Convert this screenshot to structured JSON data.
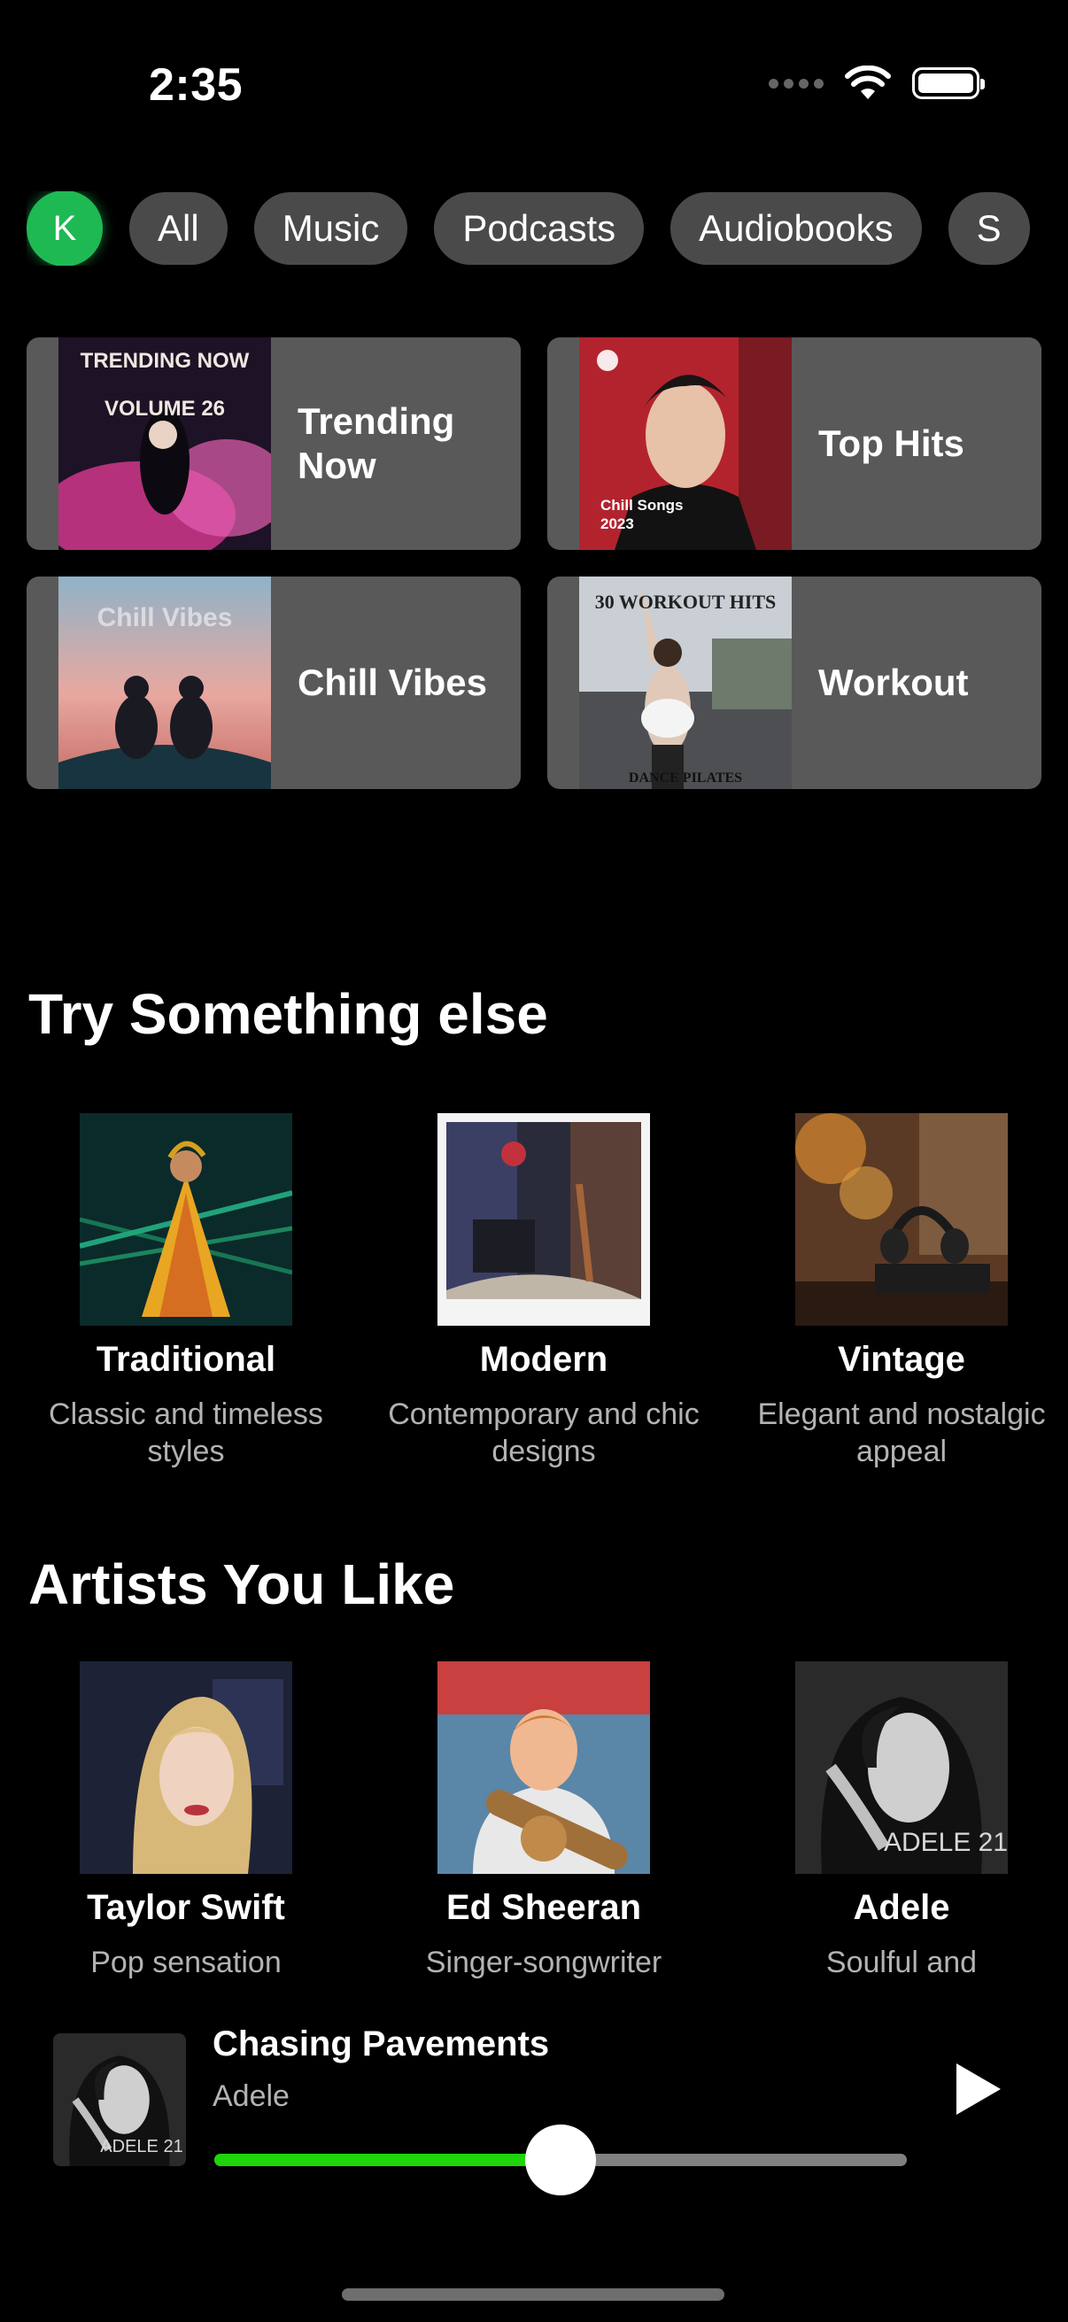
{
  "status_bar": {
    "time": "2:35"
  },
  "filters": {
    "avatar_initial": "K",
    "chips": [
      "All",
      "Music",
      "Podcasts",
      "Audiobooks",
      "S"
    ]
  },
  "quick_tiles": [
    {
      "label": "Trending Now",
      "art_text_1": "TRENDING NOW",
      "art_text_2": "VOLUME 26"
    },
    {
      "label": "Top Hits",
      "art_text_1": "Chill Songs",
      "art_text_2": "2023"
    },
    {
      "label": "Chill Vibes",
      "art_text_1": "Chill Vibes"
    },
    {
      "label": "Workout",
      "art_text_1": "30 WORKOUT HITS",
      "art_text_2": "DANCE PILATES"
    }
  ],
  "try_section": {
    "title": "Try Something else",
    "cards": [
      {
        "title": "Traditional",
        "subtitle": "Classic and timeless styles"
      },
      {
        "title": "Modern",
        "subtitle": "Contemporary and chic designs"
      },
      {
        "title": "Vintage",
        "subtitle": "Elegant and nostalgic appeal"
      }
    ]
  },
  "artists_section": {
    "title": "Artists You Like",
    "cards": [
      {
        "title": "Taylor Swift",
        "subtitle": "Pop sensation"
      },
      {
        "title": "Ed Sheeran",
        "subtitle": "Singer-songwriter"
      },
      {
        "title": "Adele",
        "subtitle": "Soulful and",
        "art_text": "ADELE 21"
      }
    ]
  },
  "player": {
    "title": "Chasing Pavements",
    "artist": "Adele",
    "art_text": "ADELE 21",
    "progress": 0.5,
    "play_icon": "play-icon"
  },
  "colors": {
    "accent": "#1ed40a",
    "avatar": "#1fb954",
    "tile_bg": "#595959",
    "chip_bg": "#4a4a4a"
  }
}
